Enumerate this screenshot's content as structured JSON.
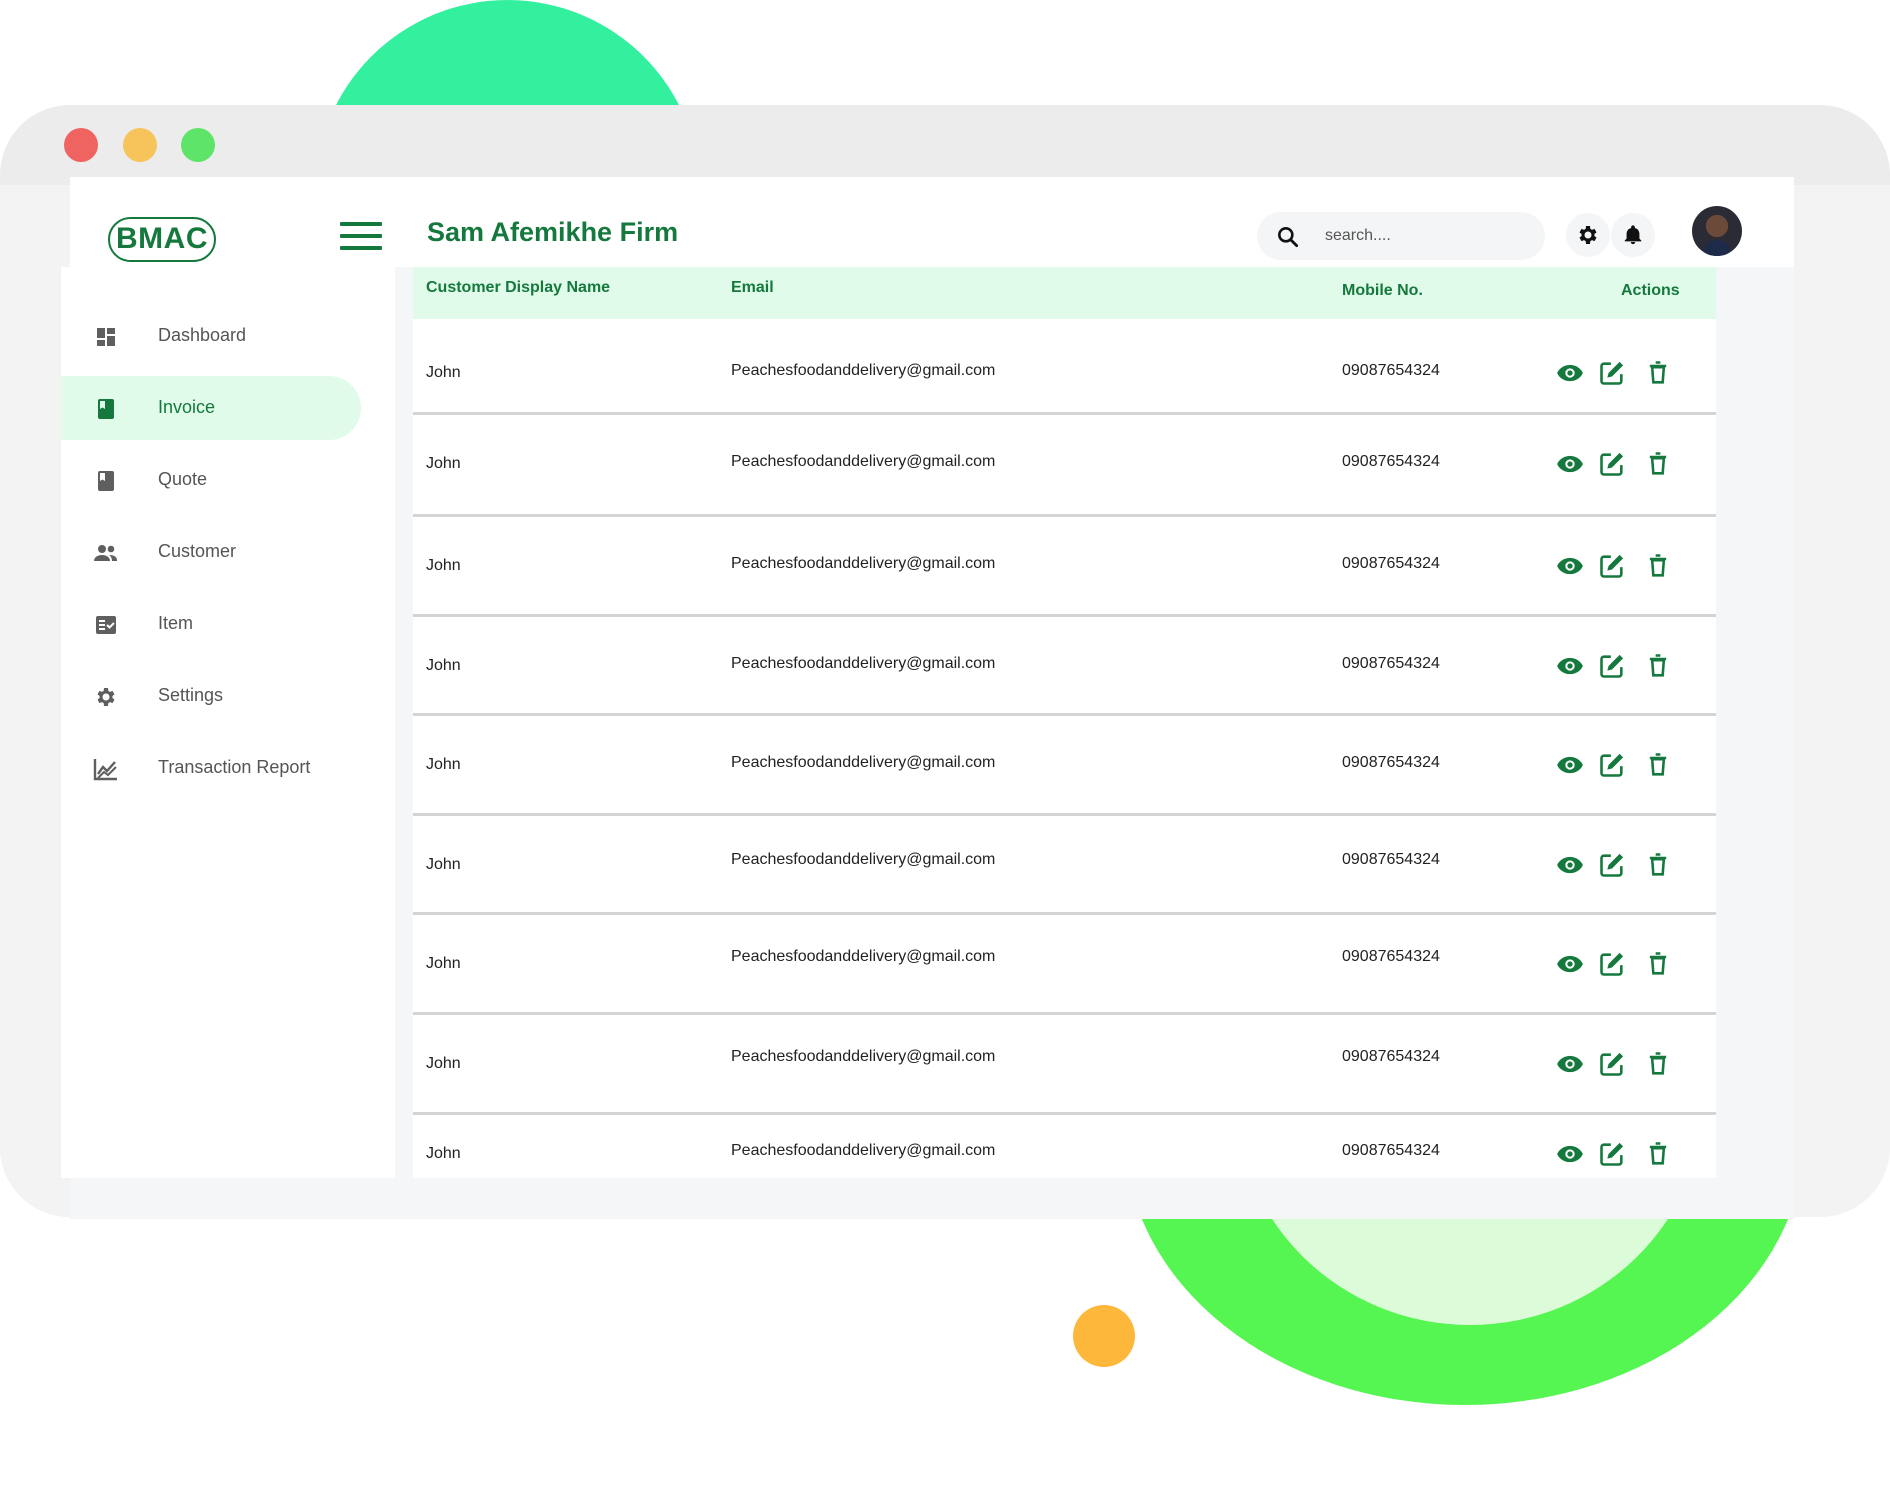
{
  "app": {
    "logo_text": "BMAC",
    "firm_title": "Sam Afemikhe Firm"
  },
  "search": {
    "placeholder": "search...."
  },
  "sidebar": {
    "items": [
      {
        "label": "Dashboard",
        "icon": "dashboard-icon"
      },
      {
        "label": "Invoice",
        "icon": "invoice-icon",
        "active": true
      },
      {
        "label": "Quote",
        "icon": "quote-icon"
      },
      {
        "label": "Customer",
        "icon": "customer-icon"
      },
      {
        "label": "Item",
        "icon": "item-icon"
      },
      {
        "label": "Settings",
        "icon": "settings-icon"
      },
      {
        "label": "Transaction Report",
        "icon": "report-icon"
      }
    ]
  },
  "table": {
    "headers": {
      "name": "Customer Display Name",
      "email": "Email",
      "mobile": "Mobile No.",
      "actions": "Actions"
    },
    "rows": [
      {
        "name": "John",
        "email": "Peachesfoodanddelivery@gmail.com",
        "mobile": "09087654324"
      },
      {
        "name": "John",
        "email": "Peachesfoodanddelivery@gmail.com",
        "mobile": "09087654324"
      },
      {
        "name": "John",
        "email": "Peachesfoodanddelivery@gmail.com",
        "mobile": "09087654324"
      },
      {
        "name": "John",
        "email": "Peachesfoodanddelivery@gmail.com",
        "mobile": "09087654324"
      },
      {
        "name": "John",
        "email": "Peachesfoodanddelivery@gmail.com",
        "mobile": "09087654324"
      },
      {
        "name": "John",
        "email": "Peachesfoodanddelivery@gmail.com",
        "mobile": "09087654324"
      },
      {
        "name": "John",
        "email": "Peachesfoodanddelivery@gmail.com",
        "mobile": "09087654324"
      },
      {
        "name": "John",
        "email": "Peachesfoodanddelivery@gmail.com",
        "mobile": "09087654324"
      },
      {
        "name": "John",
        "email": "Peachesfoodanddelivery@gmail.com",
        "mobile": "09087654324"
      }
    ]
  },
  "colors": {
    "brand_green": "#15793e",
    "active_bg": "#e0fbe9"
  }
}
